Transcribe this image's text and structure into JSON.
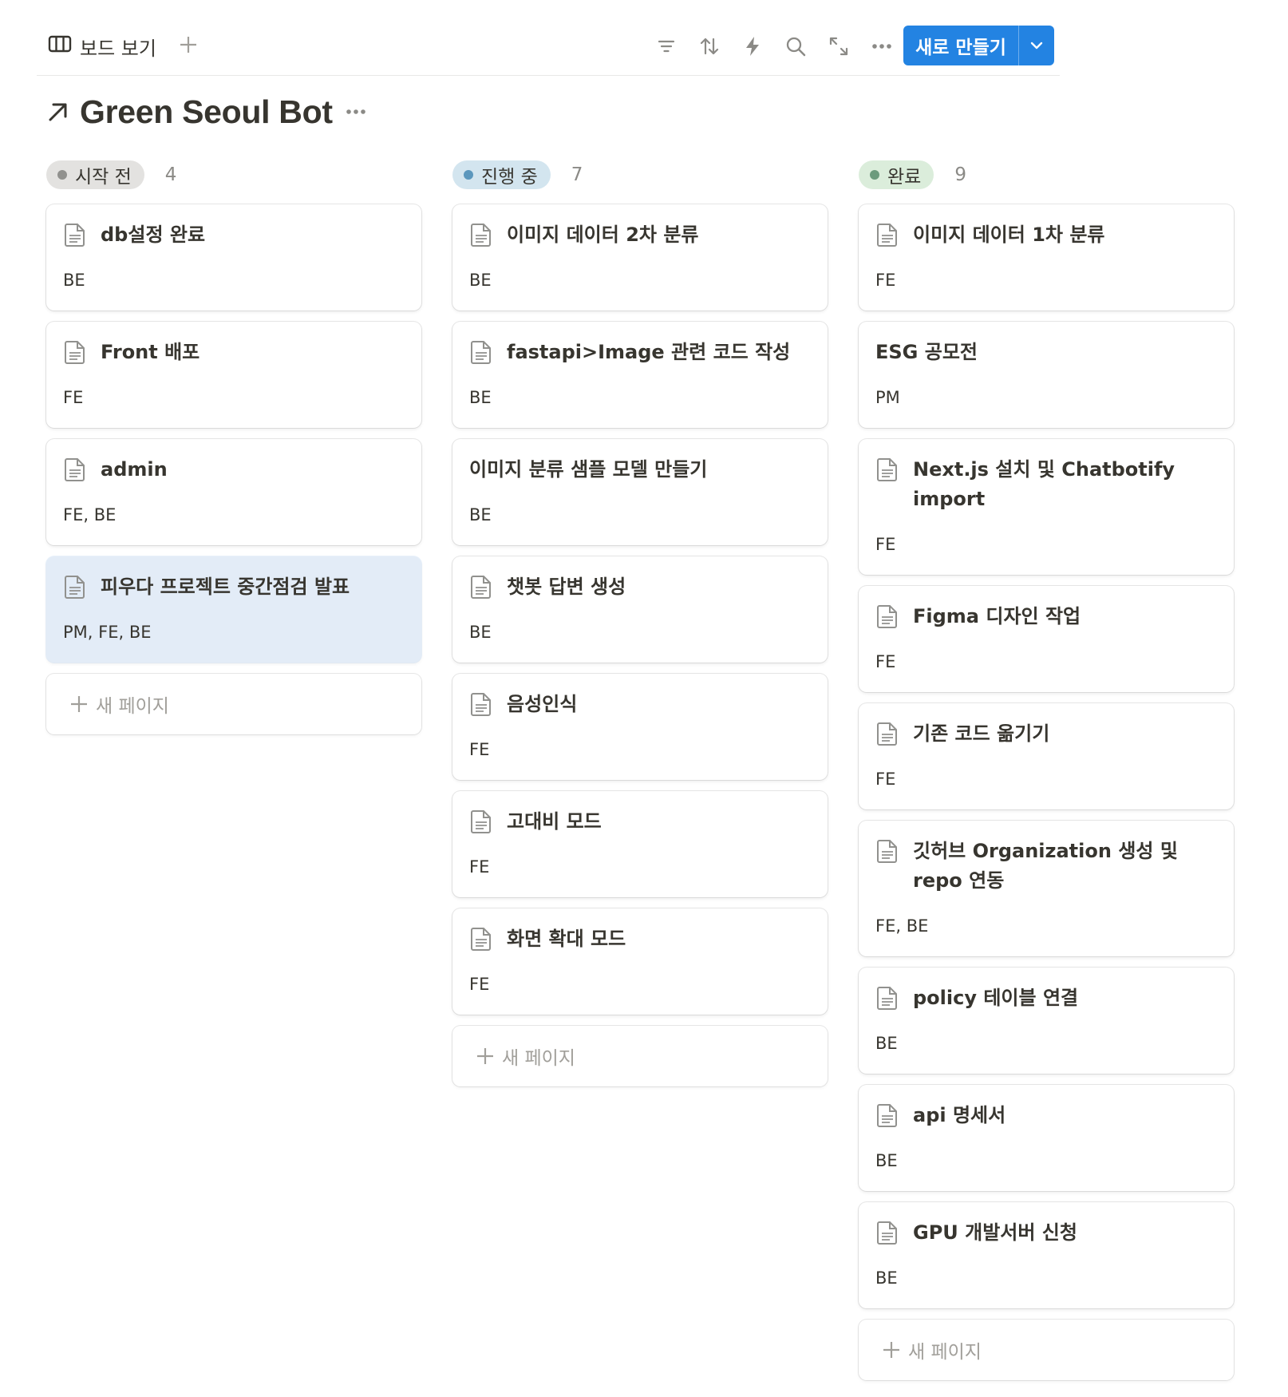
{
  "toolbar": {
    "view_label": "보드 보기",
    "new_button_label": "새로 만들기",
    "tool_icons": [
      "filter-icon",
      "sort-icon",
      "automation-icon",
      "search-icon",
      "expand-icon",
      "more-icon"
    ]
  },
  "page_title": "Green Seoul Bot",
  "colors": {
    "accent": "#2383e2",
    "not_started_bg": "#e3e2e0",
    "not_started_dot": "#91918e",
    "in_progress_bg": "#d3e5ef",
    "in_progress_dot": "#5b97bd",
    "done_bg": "#dbeddb",
    "done_dot": "#6c9b7d",
    "highlight_card": "#e3ecf7"
  },
  "new_page_label": "새 페이지",
  "columns": [
    {
      "status": "시작 전",
      "count": "4",
      "cards": [
        {
          "title": "db설정 완료",
          "tags": "BE"
        },
        {
          "title": "Front 배포",
          "tags": "FE"
        },
        {
          "title": "admin",
          "tags": "FE, BE"
        },
        {
          "title": "피우다 프로젝트 중간점검 발표",
          "tags": "PM, FE, BE"
        }
      ]
    },
    {
      "status": "진행 중",
      "count": "7",
      "cards": [
        {
          "title": "이미지 데이터 2차 분류",
          "tags": "BE"
        },
        {
          "title": "fastapi>Image 관련 코드 작성",
          "tags": "BE"
        },
        {
          "title": "이미지 분류 샘플 모델 만들기",
          "tags": "BE"
        },
        {
          "title": "챗봇 답변 생성",
          "tags": "BE"
        },
        {
          "title": "음성인식",
          "tags": "FE"
        },
        {
          "title": "고대비 모드",
          "tags": "FE"
        },
        {
          "title": "화면 확대 모드",
          "tags": "FE"
        }
      ]
    },
    {
      "status": "완료",
      "count": "9",
      "cards": [
        {
          "title": "이미지 데이터 1차 분류",
          "tags": "FE"
        },
        {
          "title": "ESG 공모전",
          "tags": "PM"
        },
        {
          "title": "Next.js 설치 및 Chatbotify import",
          "tags": "FE"
        },
        {
          "title": "Figma 디자인 작업",
          "tags": "FE"
        },
        {
          "title": "기존 코드 옮기기",
          "tags": "FE"
        },
        {
          "title": "깃허브 Organization 생성 및 repo 연동",
          "tags": "FE, BE"
        },
        {
          "title": "policy 테이블 연결",
          "tags": "BE"
        },
        {
          "title": "api 명세서",
          "tags": "BE"
        },
        {
          "title": "GPU 개발서버 신청",
          "tags": "BE"
        }
      ]
    }
  ]
}
